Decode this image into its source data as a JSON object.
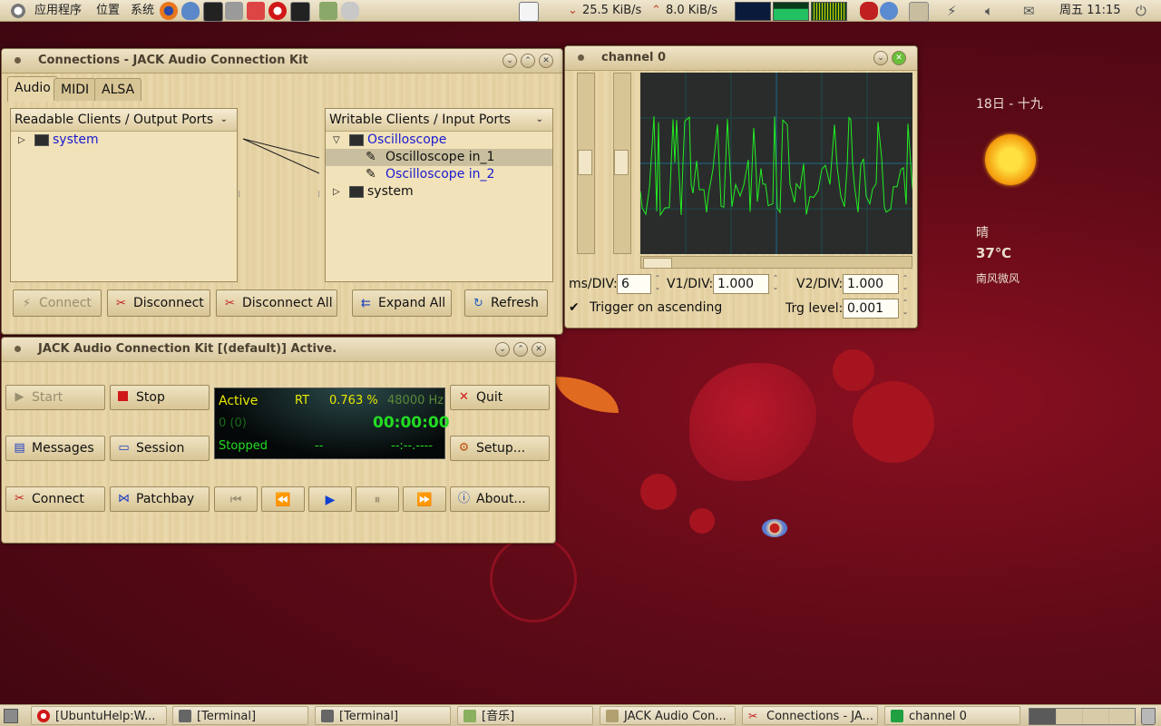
{
  "top_panel": {
    "menu_apps": "应用程序",
    "menu_places": "位置",
    "menu_system": "系统",
    "net_down": "25.5 KiB/s",
    "net_up": "8.0 KiB/s",
    "clock": "周五 11:15"
  },
  "desktop_weather": {
    "date": "18日 - 十九",
    "condition": "晴",
    "temperature": "37℃",
    "wind": "南风微风"
  },
  "connections_window": {
    "title": "Connections - JACK Audio Connection Kit",
    "tabs": [
      "Audio",
      "MIDI",
      "ALSA"
    ],
    "left_header": "Readable Clients / Output Ports",
    "right_header": "Writable Clients / Input Ports",
    "left_items": [
      "system"
    ],
    "right_client": "Oscilloscope",
    "right_ports": [
      "Oscilloscope in_1",
      "Oscilloscope in_2"
    ],
    "right_other": "system",
    "buttons": {
      "connect": "Connect",
      "disconnect": "Disconnect",
      "disconnect_all": "Disconnect All",
      "expand_all": "Expand All",
      "refresh": "Refresh"
    }
  },
  "channel_window": {
    "title": "channel 0",
    "ms_div_label": "ms/DIV:",
    "ms_div_value": "6",
    "v1_label": "V1/DIV:",
    "v1_value": "1.000",
    "v2_label": "V2/DIV:",
    "v2_value": "1.000",
    "trigger_label": "Trigger on ascending",
    "trg_level_label": "Trg level:",
    "trg_level_value": "0.001"
  },
  "jack_window": {
    "title": "JACK Audio Connection Kit [(default)] Active.",
    "buttons": {
      "start": "Start",
      "stop": "Stop",
      "quit": "Quit",
      "messages": "Messages",
      "session": "Session",
      "setup": "Setup...",
      "connect": "Connect",
      "patchbay": "Patchbay",
      "about": "About..."
    },
    "display": {
      "status": "Active",
      "rt": "RT",
      "dsp": "0.763 %",
      "rate": "48000 Hz",
      "xruns": "0 (0)",
      "time": "00:00:00",
      "transport": "Stopped",
      "bpm": "--",
      "bbt": "--:--.----"
    }
  },
  "taskbar": [
    {
      "label": "[UbuntuHelp:W...",
      "icon": "opera-icon"
    },
    {
      "label": "[Terminal]",
      "icon": "terminal-icon"
    },
    {
      "label": "[Terminal]",
      "icon": "terminal-icon"
    },
    {
      "label": "[音乐]",
      "icon": "music-icon"
    },
    {
      "label": "JACK Audio Con...",
      "icon": "jack-icon"
    },
    {
      "label": "Connections - JA...",
      "icon": "connections-icon"
    },
    {
      "label": "channel 0",
      "icon": "scope-icon"
    }
  ],
  "colors": {
    "lcd_active": "#e8e800",
    "lcd_green": "#22dd22",
    "scope_trace": "#22ee22",
    "link_blue": "#1a1ad0"
  }
}
